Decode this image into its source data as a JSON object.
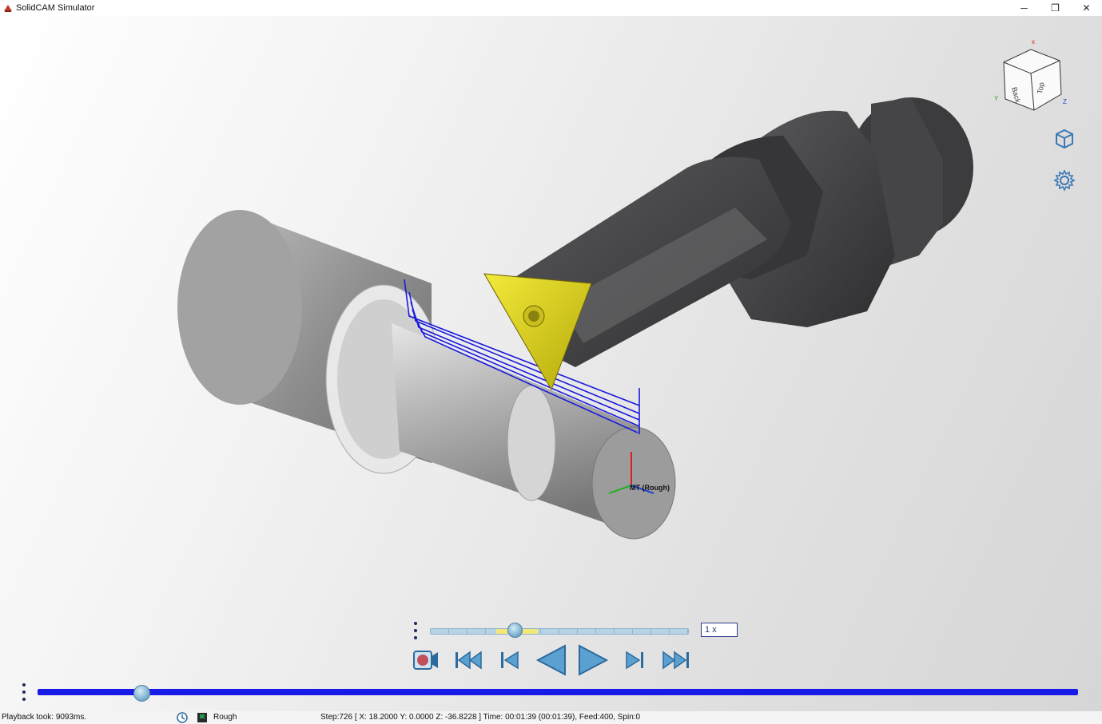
{
  "window": {
    "title": "SolidCAM Simulator",
    "controls": {
      "minimize": "─",
      "restore": "❐",
      "close": "✕"
    }
  },
  "scene": {
    "coordinate_label": "MT (Rough)",
    "viewcube": {
      "face_left": "Back",
      "face_right": "Top",
      "axis_x": "x",
      "axis_y": "Y",
      "axis_z": "Z"
    },
    "colors": {
      "toolpath": "#1a1adc",
      "insert": "#d8cc12",
      "holder": "#4a4a4c",
      "stock": "#9c9c9c"
    }
  },
  "sidebar_icons": [
    "view-cube-icon",
    "settings-gear-icon"
  ],
  "playback": {
    "speed_label": "1 x",
    "speed_level": 0.33,
    "timeline_position": 0.1,
    "buttons": [
      "record-icon",
      "rewind-to-start-icon",
      "step-back-icon",
      "play-reverse-icon",
      "play-forward-icon",
      "step-forward-icon",
      "fast-forward-to-end-icon"
    ]
  },
  "status": {
    "playback_time": "Playback took: 9093ms.",
    "operation": "Rough",
    "step_info": "Step:726 [ X: 18.2000 Y: 0.0000 Z: -36.8228 ] Time: 00:01:39 (00:01:39), Feed:400, Spin:0"
  }
}
